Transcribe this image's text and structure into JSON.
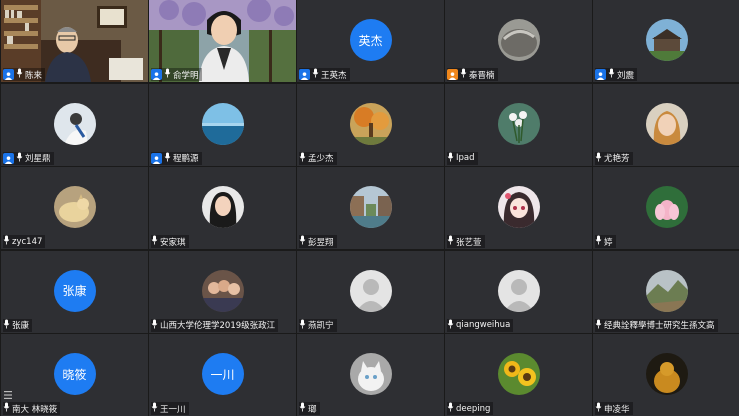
{
  "participants": [
    {
      "name": "陈来",
      "type": "video",
      "host": "blue"
    },
    {
      "name": "俞学明",
      "type": "video",
      "host": "blue"
    },
    {
      "name": "王英杰",
      "type": "text",
      "host": "blue",
      "avatar_text": "英杰"
    },
    {
      "name": "秦晋楠",
      "type": "image",
      "host": "orange",
      "image": "rock-photo"
    },
    {
      "name": "刘震",
      "type": "image",
      "host": "blue",
      "image": "building-photo"
    },
    {
      "name": "刘星鼎",
      "type": "image",
      "host": "blue",
      "image": "person-white-photo"
    },
    {
      "name": "程鹏源",
      "type": "image",
      "host": "blue",
      "image": "sea-photo"
    },
    {
      "name": "孟少杰",
      "type": "image",
      "host": "none",
      "image": "tree-photo"
    },
    {
      "name": "Ipad",
      "type": "image",
      "host": "none",
      "image": "flowers-photo"
    },
    {
      "name": "尤艳芳",
      "type": "image",
      "host": "none",
      "image": "woman-photo"
    },
    {
      "name": "zyc147",
      "type": "image",
      "host": "none",
      "image": "cat-photo"
    },
    {
      "name": "安家琪",
      "type": "image",
      "host": "none",
      "image": "girl-photo"
    },
    {
      "name": "彭昱翔",
      "type": "image",
      "host": "none",
      "image": "canal-photo"
    },
    {
      "name": "张艺萱",
      "type": "image",
      "host": "none",
      "image": "anime-photo"
    },
    {
      "name": "婷",
      "type": "image",
      "host": "none",
      "image": "lotus-photo"
    },
    {
      "name": "张康",
      "type": "text",
      "host": "none",
      "avatar_text": "张康"
    },
    {
      "name": "山西大学伦理学2019级张政江",
      "type": "image",
      "host": "none",
      "image": "group-photo"
    },
    {
      "name": "燕凯宁",
      "type": "default",
      "host": "none"
    },
    {
      "name": "qiangweihua",
      "type": "default",
      "host": "none"
    },
    {
      "name": "经典詮釋學博士研究生孫文高",
      "type": "image",
      "host": "none",
      "image": "landscape-photo"
    },
    {
      "name": "南大 林晓筱",
      "type": "text",
      "host": "none",
      "avatar_text": "晓筱"
    },
    {
      "name": "王一川",
      "type": "text",
      "host": "none",
      "avatar_text": "一川"
    },
    {
      "name": "瑯",
      "type": "image",
      "host": "none",
      "image": "white-cat-photo"
    },
    {
      "name": "deeping",
      "type": "image",
      "host": "none",
      "image": "sunflower-photo"
    },
    {
      "name": "申凌华",
      "type": "image",
      "host": "none",
      "image": "buddha-photo"
    }
  ],
  "colors": {
    "tile": "#2e2f33",
    "accent": "#1e7cf2",
    "host_orange": "#f0871b"
  }
}
